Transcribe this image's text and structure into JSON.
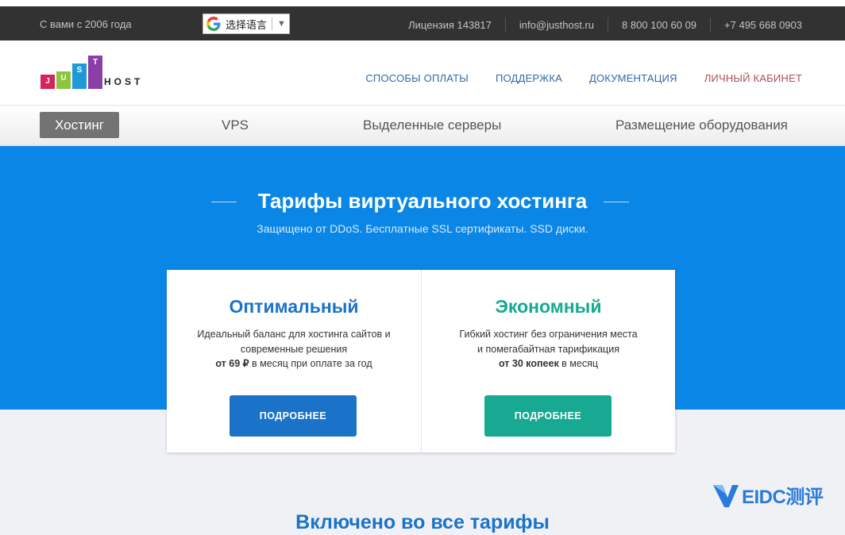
{
  "topbar": {
    "since": "С вами с 2006 года",
    "translate_label": "选择语言",
    "translate_arrow": "▼",
    "license": "Лицензия 143817",
    "email": "info@justhost.ru",
    "phone_free": "8 800 100 60 09",
    "phone_msk": "+7 495 668 0903"
  },
  "logo": {
    "letters": [
      "J",
      "U",
      "S",
      "T"
    ],
    "host": "HOST"
  },
  "mainnav": {
    "payment": "СПОСОБЫ ОПЛАТЫ",
    "support": "ПОДДЕРЖКА",
    "docs": "ДОКУМЕНТАЦИЯ",
    "cabinet": "ЛИЧНЫЙ КАБИНЕТ"
  },
  "subnav": {
    "hosting": "Хостинг",
    "vps": "VPS",
    "dedicated": "Выделенные серверы",
    "colocation": "Размещение оборудования"
  },
  "hero": {
    "title": "Тарифы виртуального хостинга",
    "subtitle": "Защищено от DDoS. Бесплатные SSL сертификаты. SSD диски."
  },
  "plans": [
    {
      "name": "Оптимальный",
      "line1": "Идеальный баланс для хостинга сайтов и",
      "line2": "современные решения",
      "price_bold": "от 69 ₽",
      "price_rest": " в месяц при оплате за год",
      "button": "ПОДРОБНЕЕ",
      "color": "#1a73c9"
    },
    {
      "name": "Экономный",
      "line1": "Гибкий хостинг без ограничения места",
      "line2": "и помегабайтная тарификация",
      "price_bold": "от 30 копеек",
      "price_rest": " в месяц",
      "button": "ПОДРОБНЕЕ",
      "color": "#17a991"
    }
  ],
  "included_title": "Включено во все тарифы",
  "watermark": "EIDC测评",
  "colors": {
    "topbar": "#333232",
    "hero": "#0a87e6",
    "logo_j": "#d6245a",
    "logo_u": "#8dc53e",
    "logo_s": "#1f9ad6",
    "logo_t": "#8a3fa6"
  }
}
